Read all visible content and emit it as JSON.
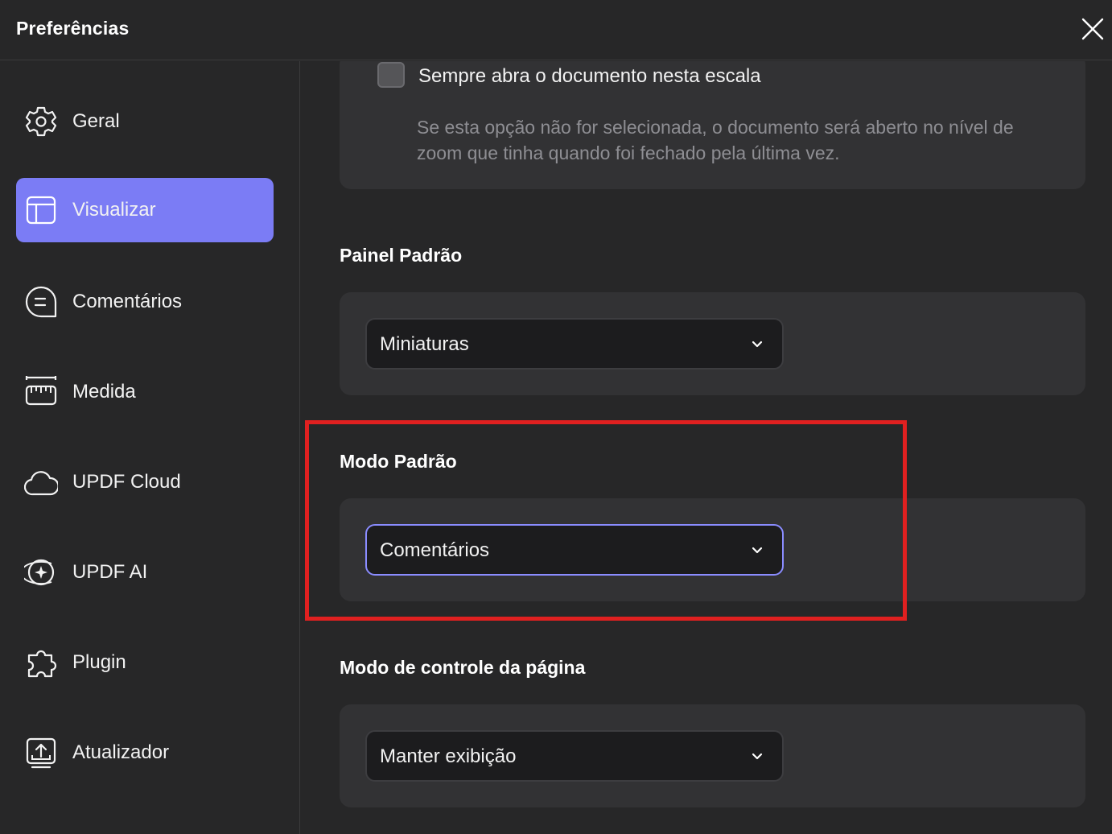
{
  "window": {
    "title": "Preferências"
  },
  "sidebar": {
    "items": [
      {
        "label": "Geral",
        "icon": "gear-icon",
        "active": false
      },
      {
        "label": "Visualizar",
        "icon": "layout-icon",
        "active": true
      },
      {
        "label": "Comentários",
        "icon": "comment-icon",
        "active": false
      },
      {
        "label": "Medida",
        "icon": "ruler-icon",
        "active": false
      },
      {
        "label": "UPDF Cloud",
        "icon": "cloud-icon",
        "active": false
      },
      {
        "label": "UPDF AI",
        "icon": "ai-sparkle-icon",
        "active": false
      },
      {
        "label": "Plugin",
        "icon": "puzzle-icon",
        "active": false
      },
      {
        "label": "Atualizador",
        "icon": "update-icon",
        "active": false
      }
    ]
  },
  "zoom_option": {
    "checkbox_label": "Sempre abra o documento nesta escala",
    "checked": false,
    "helper_line1": "Se esta opção não for selecionada, o documento será aberto no nível de",
    "helper_line2": "zoom que tinha quando foi fechado pela última vez."
  },
  "painel_padrao": {
    "title": "Painel Padrão",
    "value": "Miniaturas"
  },
  "modo_padrao": {
    "title": "Modo Padrão",
    "value": "Comentários"
  },
  "modo_controle": {
    "title": "Modo de controle da página",
    "value": "Manter exibição"
  },
  "colors": {
    "accent": "#7b7cf5",
    "focus_border": "#8a8cff",
    "highlight": "#e02020",
    "background": "#272728",
    "card": "#323234"
  }
}
